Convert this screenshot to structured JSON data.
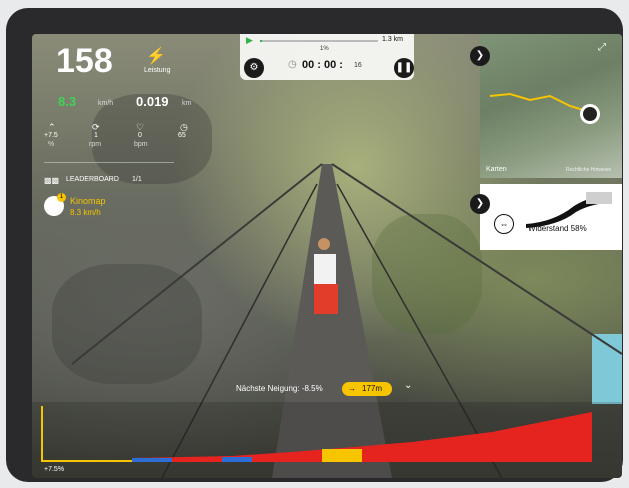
{
  "stats": {
    "power_value": "158",
    "power_label": "Leistung",
    "speed_value": "8.3",
    "speed_unit": "km/h",
    "distance_value": "0.019",
    "distance_unit": "km",
    "slope_value": "+7.5",
    "slope_unit": "%",
    "cadence_value": "1",
    "cadence_unit": "rpm",
    "heart_value": "0",
    "heart_unit": "bpm",
    "extra_value": "65"
  },
  "leaderboard": {
    "title": "LEADERBOARD",
    "count": "1/1",
    "entry_name": "Kinomap",
    "entry_speed": "8.3 km/h",
    "entry_rank": "1"
  },
  "topbar": {
    "progress_percent": "1%",
    "progress_fraction": 0.01,
    "total_distance": "1.3 km",
    "timer": "00 : 00 :",
    "timer_seconds": "16"
  },
  "map": {
    "attribution": "Karten",
    "legal": "Rechtliche Hinweise"
  },
  "resistance": {
    "label": "Widerstand 58%",
    "fraction": 0.58
  },
  "next_slope": {
    "label": "Nächste Neigung: -8.5%",
    "distance": "177m"
  },
  "chart": {
    "start_label": "+7.5%"
  },
  "colors": {
    "accent_yellow": "#f7c400",
    "green": "#2db34a",
    "red": "#e52420",
    "blue": "#2d6ed6"
  }
}
